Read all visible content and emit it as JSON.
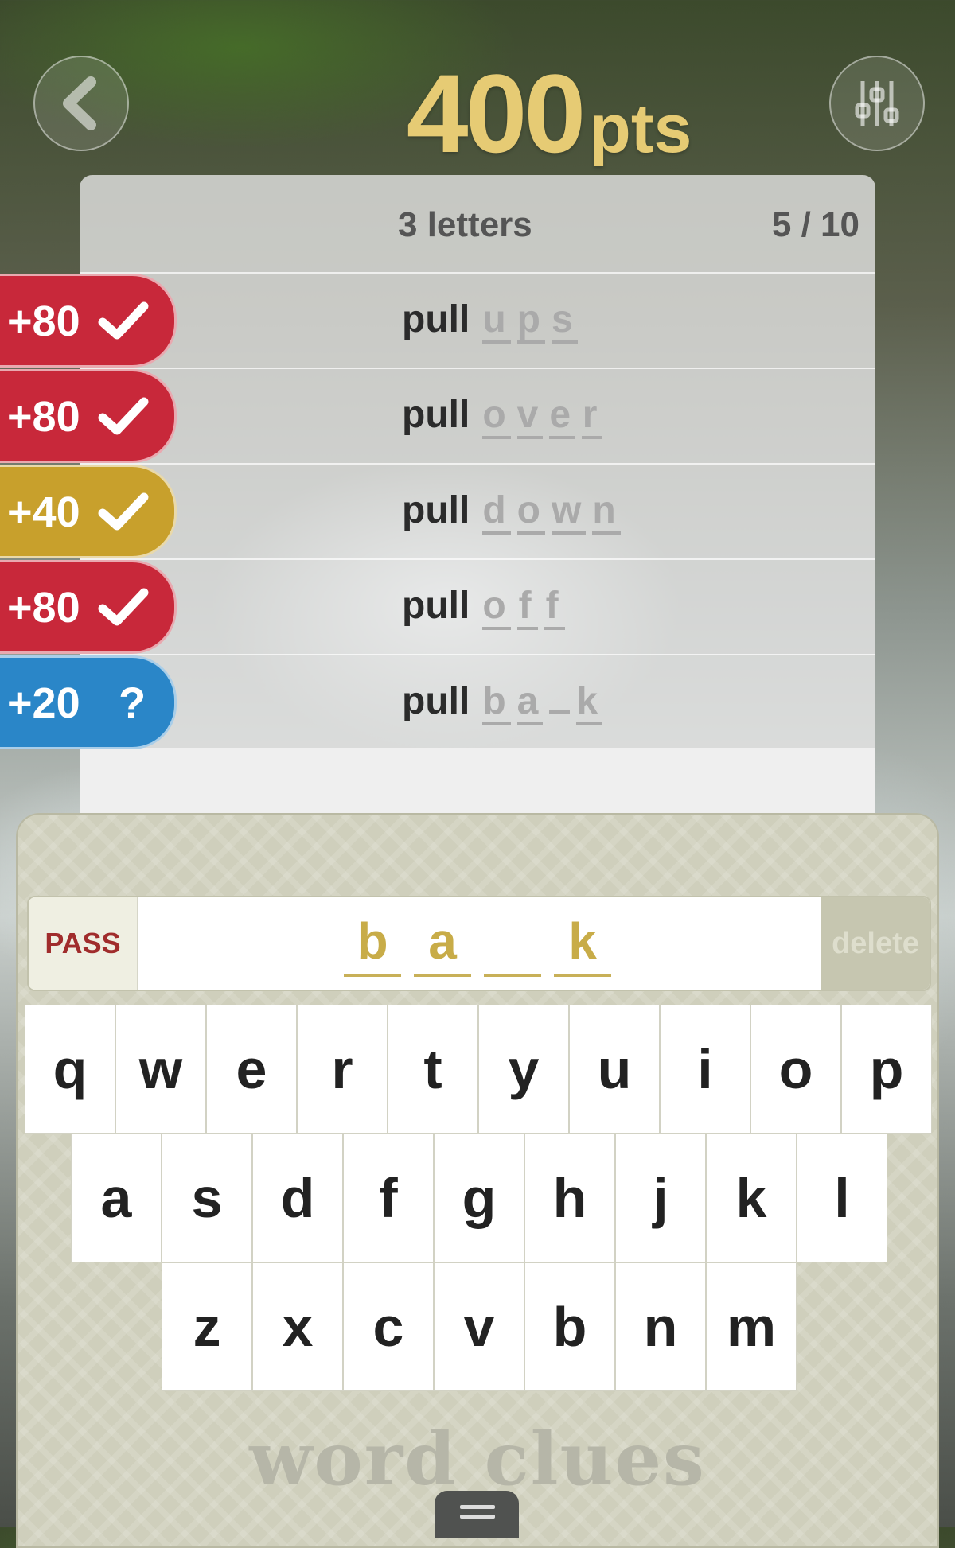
{
  "header": {
    "score_value": "400",
    "score_unit": "pts"
  },
  "card": {
    "letters_label": "3 letters",
    "progress": "5 / 10"
  },
  "rows": [
    {
      "points": "+80",
      "mark": "check",
      "base": "pull",
      "answer": [
        "u",
        "p",
        "s"
      ],
      "color": "#c8283a"
    },
    {
      "points": "+80",
      "mark": "check",
      "base": "pull",
      "answer": [
        "o",
        "v",
        "e",
        "r"
      ],
      "color": "#c8283a"
    },
    {
      "points": "+40",
      "mark": "check",
      "base": "pull",
      "answer": [
        "d",
        "o",
        "w",
        "n"
      ],
      "color": "#c8a02c"
    },
    {
      "points": "+80",
      "mark": "check",
      "base": "pull",
      "answer": [
        "o",
        "f",
        "f"
      ],
      "color": "#c8283a"
    },
    {
      "points": "+20",
      "mark": "?",
      "base": "pull",
      "answer": [
        "b",
        "a",
        "",
        "k"
      ],
      "color": "#2a86c8"
    }
  ],
  "input": {
    "pass_label": "PASS",
    "delete_label": "delete",
    "typed": [
      "b",
      "a",
      "",
      "k"
    ]
  },
  "keyboard": {
    "row1": [
      "q",
      "w",
      "e",
      "r",
      "t",
      "y",
      "u",
      "i",
      "o",
      "p"
    ],
    "row2": [
      "a",
      "s",
      "d",
      "f",
      "g",
      "h",
      "j",
      "k",
      "l"
    ],
    "row3": [
      "z",
      "x",
      "c",
      "v",
      "b",
      "n",
      "m"
    ]
  },
  "brand": "word clues"
}
